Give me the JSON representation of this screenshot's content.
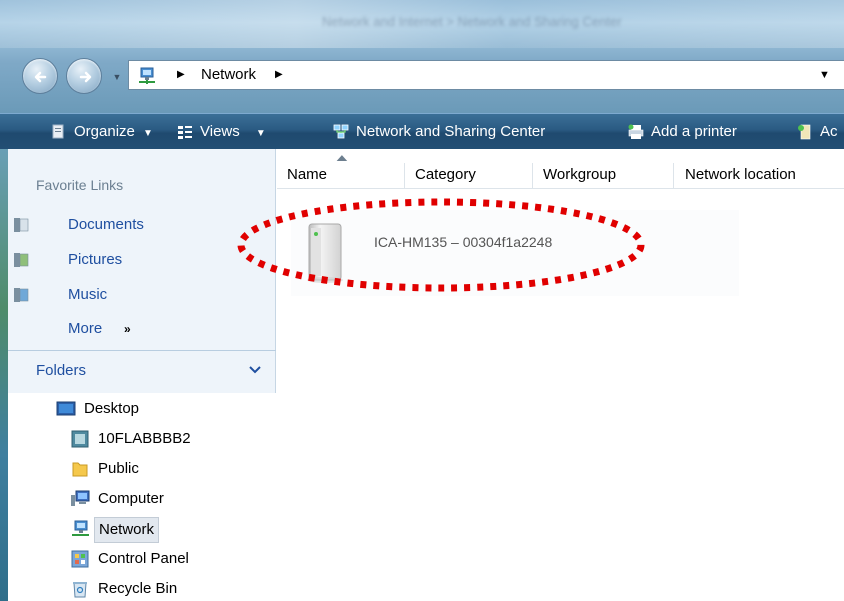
{
  "window": {
    "title": "Network and Internet > Network and Sharing Center"
  },
  "address_bar": {
    "path": "Network",
    "icon": "network-icon"
  },
  "command_bar": {
    "items": [
      {
        "label": "Organize",
        "icon": "organize-icon",
        "dropdown": true
      },
      {
        "label": "Views",
        "icon": "views-icon",
        "dropdown": true
      },
      {
        "label": "Network and Sharing Center",
        "icon": "network-sharing-icon",
        "dropdown": false
      },
      {
        "label": "Add a printer",
        "icon": "printer-icon",
        "dropdown": false
      },
      {
        "label": "Ac",
        "icon": "add-device-icon",
        "dropdown": false
      }
    ]
  },
  "sidebar": {
    "favorites_header": "Favorite Links",
    "favorites": [
      {
        "label": "Documents",
        "icon": "documents-icon"
      },
      {
        "label": "Pictures",
        "icon": "pictures-icon"
      },
      {
        "label": "Music",
        "icon": "music-icon"
      }
    ],
    "more_label": "More",
    "more_chevron": "»",
    "folders_header": "Folders",
    "folders": [
      {
        "label": "Desktop",
        "icon": "desktop-icon"
      },
      {
        "label": "10FLABBBB2",
        "icon": "user-folder-icon"
      },
      {
        "label": "Public",
        "icon": "folder-icon"
      },
      {
        "label": "Computer",
        "icon": "computer-icon"
      },
      {
        "label": "Network",
        "icon": "network-icon",
        "selected": true
      },
      {
        "label": "Control Panel",
        "icon": "control-panel-icon"
      },
      {
        "label": "Recycle Bin",
        "icon": "recycle-bin-icon"
      }
    ]
  },
  "columns": [
    {
      "label": "Name",
      "sorted": true
    },
    {
      "label": "Category"
    },
    {
      "label": "Workgroup"
    },
    {
      "label": "Network location"
    }
  ],
  "items": [
    {
      "label": "ICA-HM135 – 00304f1a2248",
      "icon": "network-device-icon"
    }
  ],
  "annotation": {
    "color": "#e00000"
  },
  "colors": {
    "command_bar": "#2a5a82",
    "link": "#1f4fa0",
    "sidebar_bg": "#eef4fa"
  }
}
